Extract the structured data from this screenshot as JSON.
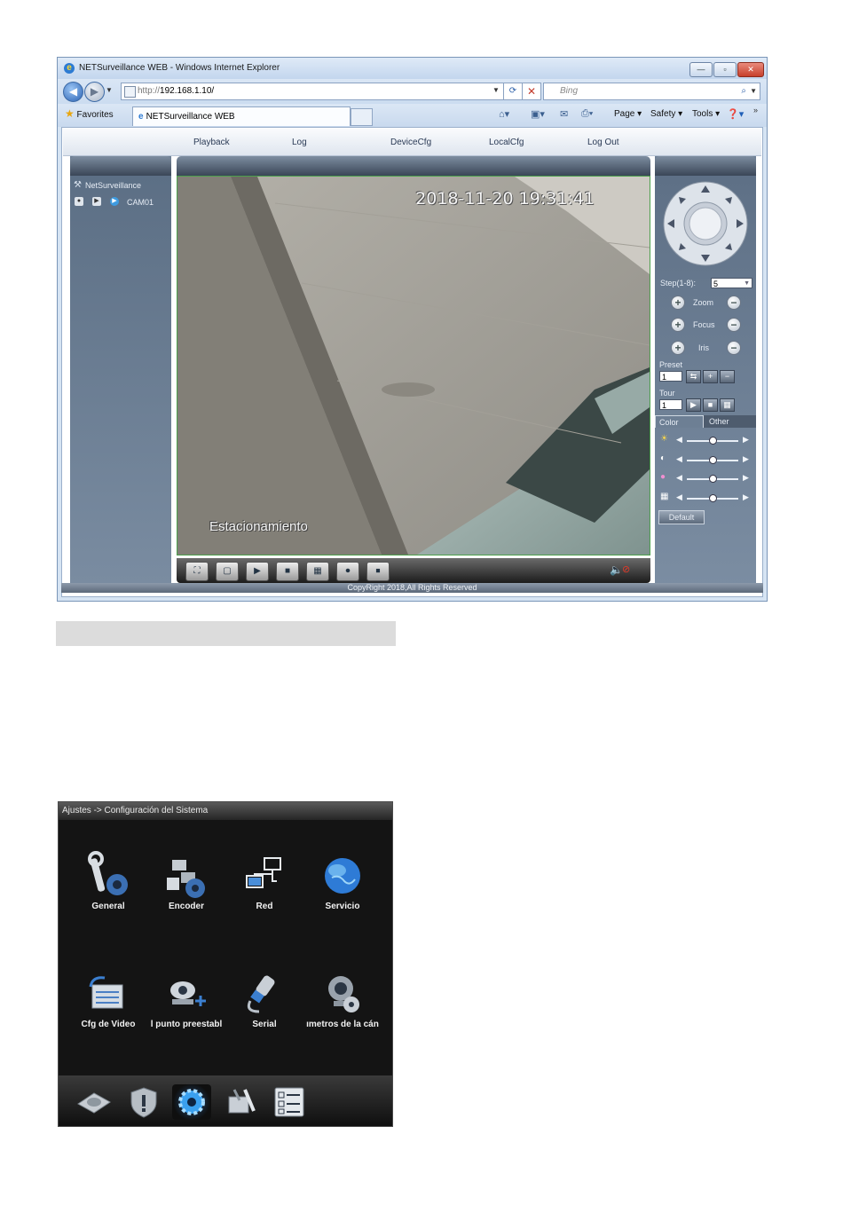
{
  "browser": {
    "title": "NETSurveillance WEB - Windows Internet Explorer",
    "window_buttons": [
      "—",
      "▫",
      "✕"
    ],
    "address": {
      "prefix": "http://",
      "host": "192.168.1.10/"
    },
    "search_placeholder": "Bing",
    "favorites_label": "Favorites",
    "tab_label": "NETSurveillance WEB",
    "commands": [
      "Page ▾",
      "Safety ▾",
      "Tools ▾"
    ]
  },
  "app": {
    "nav": [
      "Playback",
      "Log",
      "DeviceCfg",
      "LocalCfg",
      "Log Out"
    ],
    "tree_root": "NetSurveillance",
    "camera": "CAM01",
    "video": {
      "timestamp": "2018-11-20 19:31:41",
      "overlay_label": "Estacionamiento"
    },
    "ptz": {
      "step_label": "Step(1-8):",
      "step_value": "5",
      "zoom": "Zoom",
      "focus": "Focus",
      "iris": "Iris",
      "preset_label": "Preset",
      "preset_value": "1",
      "tour_label": "Tour",
      "tour_value": "1",
      "color_tab": "Color",
      "other_tab": "Other",
      "default_button": "Default",
      "slider_levels": [
        0.5,
        0.5,
        0.5,
        0.5
      ]
    },
    "footer": "CopyRight 2018,All Rights Reserved"
  },
  "dvr_menu": {
    "title": "Ajustes -> Configuración del Sistema",
    "items": [
      "General",
      "Encoder",
      "Red",
      "Servicio",
      "Cfg de Video",
      "l punto preestabl",
      "Serial",
      "ımetros de la cán"
    ],
    "icons": [
      "wrench-gear-icon",
      "encoder-blocks-icon",
      "network-icon",
      "globe-icon",
      "video-config-icon",
      "ptz-camera-icon",
      "serial-cable-icon",
      "camera-params-icon"
    ],
    "bottom_icons": [
      "hard-disk-icon",
      "shield-icon",
      "gear-icon",
      "tools-icon",
      "checklist-icon"
    ]
  }
}
